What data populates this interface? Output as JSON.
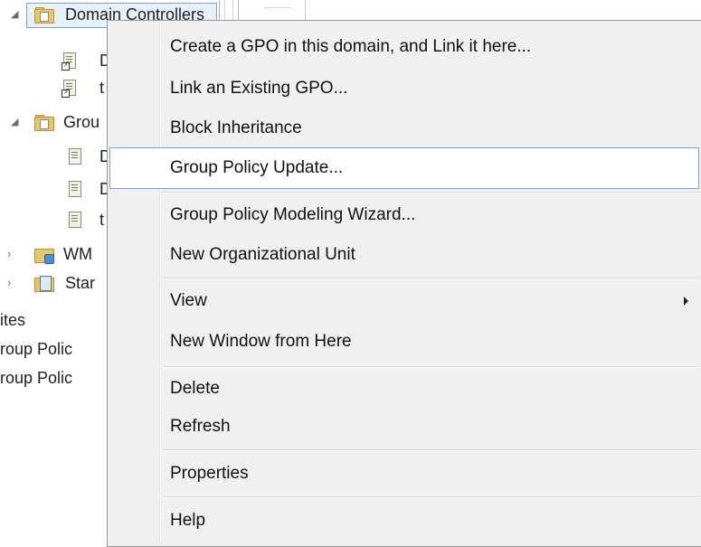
{
  "tree": {
    "selected_node_label": "Domain Controllers",
    "nodes": [
      {
        "label": "Domain Controllers",
        "icon": "ou-folder-icon"
      },
      {
        "label": "Default Domain Controllers Policy",
        "icon": "gpo-link-icon"
      },
      {
        "label": "test",
        "icon": "gpo-link-icon"
      },
      {
        "label": "Group Policy Objects",
        "icon": "gpo-folder-icon"
      },
      {
        "label": "Default Domain Policy",
        "icon": "gpo-icon"
      },
      {
        "label": "Default Domain Controllers Policy",
        "icon": "gpo-icon"
      },
      {
        "label": "test",
        "icon": "gpo-icon"
      },
      {
        "label": "WMI Filters",
        "icon": "wmi-filters-icon"
      },
      {
        "label": "Starter GPOs",
        "icon": "starter-gpos-icon"
      },
      {
        "label": "Sites",
        "icon": "none"
      },
      {
        "label": "Group Policy Modeling",
        "icon": "none"
      },
      {
        "label": "Group Policy Results",
        "icon": "none"
      }
    ],
    "visible_text": {
      "domain_controllers": "Domain Controllers",
      "gpo1": "D",
      "gpo2": "t",
      "group_policy_objects": "Grou",
      "gpo3": "D",
      "gpo4": "D",
      "gpo5": "t",
      "wmi": "WM",
      "starter": "Star",
      "sites": "ites",
      "modeling": "roup Polic",
      "results": "roup Polic"
    }
  },
  "context_menu": {
    "items": [
      {
        "label": "Create a GPO in this domain, and Link it here..."
      },
      {
        "label": "Link an Existing GPO..."
      },
      {
        "label": "Block Inheritance"
      },
      {
        "label": "Group Policy Update...",
        "state": "hover"
      },
      {
        "label": "Group Policy Modeling Wizard..."
      },
      {
        "label": "New Organizational Unit"
      },
      {
        "label": "View",
        "submenu": true
      },
      {
        "label": "New Window from Here"
      },
      {
        "label": "Delete"
      },
      {
        "label": "Refresh"
      },
      {
        "label": "Properties"
      },
      {
        "label": "Help"
      }
    ]
  },
  "colors": {
    "menu_background": "#f0f0f0",
    "hover_background": "#ffffff",
    "hover_border": "#7da2ce",
    "selection_background": "#e5f1fb"
  }
}
